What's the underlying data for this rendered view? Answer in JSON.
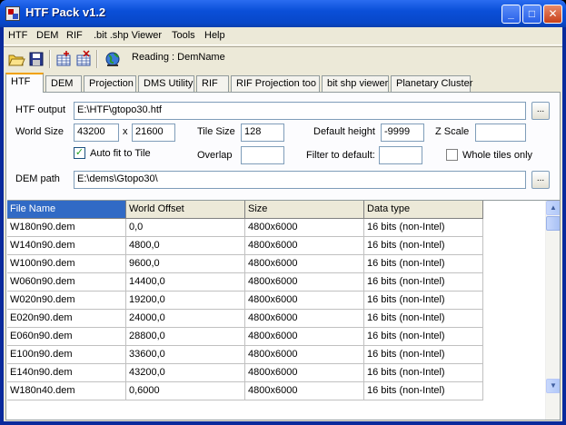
{
  "window": {
    "title": "HTF Pack v1.2"
  },
  "titlebar_buttons": {
    "minimize": "_",
    "maximize": "□",
    "close": "✕"
  },
  "menu": [
    "HTF",
    "DEM",
    "RIF",
    ".bit .shp Viewer",
    "Tools",
    "Help"
  ],
  "toolbar": {
    "icons": [
      "open-folder-icon",
      "save-icon",
      "table-add-icon",
      "table-delete-icon",
      "globe-icon"
    ],
    "status_text": "Reading : DemName"
  },
  "tabs": [
    "HTF",
    "DEM",
    "Projection",
    "DMS Utility",
    "RIF",
    "RIF Projection too",
    "bit shp viewer",
    "Planetary Cluster"
  ],
  "form": {
    "htf_output_label": "HTF output",
    "htf_output_value": "E:\\HTF\\gtopo30.htf",
    "world_size_label": "World Size",
    "world_size_x": "43200",
    "world_size_sep": "x",
    "world_size_y": "21600",
    "tile_size_label": "Tile Size",
    "tile_size_value": "128",
    "default_height_label": "Default height",
    "default_height_value": "-9999",
    "z_scale_label": "Z Scale",
    "z_scale_value": "",
    "auto_fit_label": "Auto fit to Tile",
    "auto_fit_checked": "✓",
    "overlap_label": "Overlap",
    "overlap_value": "",
    "filter_label": "Filter to default:",
    "filter_value": "",
    "whole_tiles_label": "Whole tiles only",
    "dem_path_label": "DEM path",
    "dem_path_value": "E:\\dems\\Gtopo30\\",
    "browse_label": "..."
  },
  "table": {
    "columns": [
      "File Name",
      "World Offset",
      "Size",
      "Data type"
    ],
    "rows": [
      [
        "W180n90.dem",
        "0,0",
        "4800x6000",
        "16 bits (non-Intel)"
      ],
      [
        "W140n90.dem",
        "4800,0",
        "4800x6000",
        "16 bits (non-Intel)"
      ],
      [
        "W100n90.dem",
        "9600,0",
        "4800x6000",
        "16 bits (non-Intel)"
      ],
      [
        "W060n90.dem",
        "14400,0",
        "4800x6000",
        "16 bits (non-Intel)"
      ],
      [
        "W020n90.dem",
        "19200,0",
        "4800x6000",
        "16 bits (non-Intel)"
      ],
      [
        "E020n90.dem",
        "24000,0",
        "4800x6000",
        "16 bits (non-Intel)"
      ],
      [
        "E060n90.dem",
        "28800,0",
        "4800x6000",
        "16 bits (non-Intel)"
      ],
      [
        "E100n90.dem",
        "33600,0",
        "4800x6000",
        "16 bits (non-Intel)"
      ],
      [
        "E140n90.dem",
        "43200,0",
        "4800x6000",
        "16 bits (non-Intel)"
      ],
      [
        "W180n40.dem",
        "0,6000",
        "4800x6000",
        "16 bits (non-Intel)"
      ]
    ],
    "scroll_up": "▲",
    "scroll_down": "▼"
  }
}
